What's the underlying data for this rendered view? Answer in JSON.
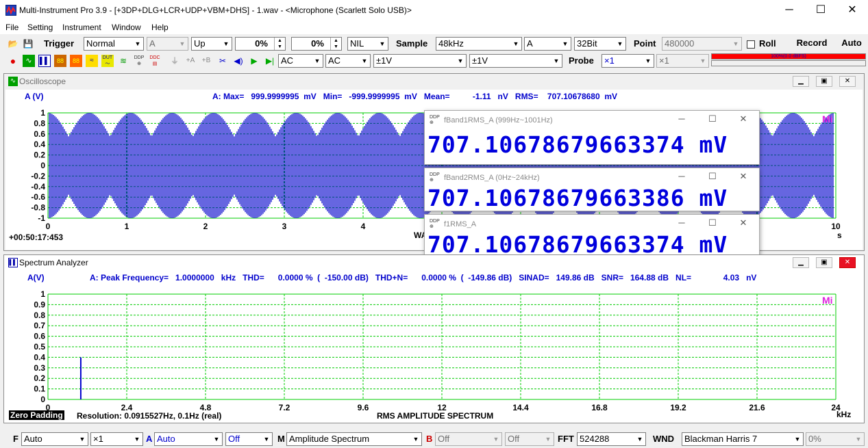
{
  "titlebar": {
    "title": "Multi-Instrument Pro 3.9   -   [+3DP+DLG+LCR+UDP+VBM+DHS]   -   1.wav   -   <Microphone (Scarlett Solo USB)>",
    "minimize": "─",
    "maximize": "☐",
    "close": "✕"
  },
  "menu": [
    "File",
    "Setting",
    "Instrument",
    "Window",
    "Help"
  ],
  "toolbar1": {
    "trigger_label": "Trigger",
    "trigger_mode": "Normal",
    "trigger_channel": "A",
    "trigger_edge": "Up",
    "trigger_level": "0%",
    "trigger_delay": "0%",
    "trigger_nil": "NIL",
    "sample_label": "Sample",
    "sample_rate": "48kHz",
    "sample_channel": "A",
    "bit_depth": "32Bit",
    "point_label": "Point",
    "point_value": "480000",
    "roll_label": "Roll",
    "record_label": "Record",
    "auto_label": "Auto"
  },
  "toolbar2": {
    "coupling_a": "AC",
    "coupling_b": "AC",
    "range_a": "±1V",
    "range_b": "±1V",
    "probe_label": "Probe",
    "probe_a": "×1",
    "probe_b": "×1",
    "level_meter": "100%(0.0 dBFS)",
    "icons": [
      "record-icon",
      "oscilloscope-icon",
      "spectrum-icon",
      "multimeter-icon",
      "generator-icon",
      "dut-icon",
      "sweep-icon",
      "ddp-icon",
      "ddc-icon",
      "probe-icon",
      "add-a-icon",
      "add-b-icon",
      "scissors-icon",
      "speaker-icon",
      "play-icon",
      "step-icon"
    ]
  },
  "oscilloscope": {
    "title": "Oscilloscope",
    "channel": "A (V)",
    "stats": "A: Max=   999.9999995  mV   Min=   -999.9999995  mV   Mean=          -1.11   nV   RMS=    707.10678680  mV",
    "timestamp": "+00:50:17:453",
    "xlabel": "WAVEFORM",
    "xunit": "s",
    "watermark": "Mi",
    "yticks": [
      "1",
      "0.8",
      "0.6",
      "0.4",
      "0.2",
      "0",
      "-0.2",
      "-0.4",
      "-0.6",
      "-0.8",
      "-1"
    ],
    "xticks": [
      "0",
      "1",
      "2",
      "3",
      "4",
      "",
      "",
      "",
      "",
      "",
      "10"
    ],
    "wave_color": "#0000cc",
    "grid_color": "#00cc00"
  },
  "floating_windows": [
    {
      "title": "fBand1RMS_A (999Hz~1001Hz)",
      "value": "707.10678679663374  mV"
    },
    {
      "title": "fBand2RMS_A (0Hz~24kHz)",
      "value": "707.10678679663386  mV"
    },
    {
      "title": "f1RMS_A",
      "value": "707.10678679663374  mV"
    }
  ],
  "spectrum": {
    "title": "Spectrum Analyzer",
    "channel": "A(V)",
    "stats": "A: Peak Frequency=   1.0000000   kHz   THD=      0.0000 %  (  -150.00 dB)   THD+N=      0.0000 %  (  -149.86 dB)   SINAD=   149.86 dB   SNR=   164.88 dB   NL=              4.03   nV",
    "zero_padding": "Zero Padding",
    "resolution": "Resolution: 0.0915527Hz, 0.1Hz (real)",
    "xlabel": "RMS AMPLITUDE  SPECTRUM",
    "xunit": "kHz",
    "watermark": "Mi",
    "yticks": [
      "1",
      "0.9",
      "0.8",
      "0.7",
      "0.6",
      "0.5",
      "0.4",
      "0.3",
      "0.2",
      "0.1",
      "0"
    ],
    "xticks": [
      "0",
      "2.4",
      "4.8",
      "7.2",
      "9.6",
      "12",
      "14.4",
      "16.8",
      "19.2",
      "21.6",
      "24"
    ]
  },
  "chart_data": {
    "type": "bar",
    "x": [
      1.0
    ],
    "values": [
      0.4
    ],
    "xlim": [
      0,
      24
    ],
    "ylim": [
      0,
      1
    ],
    "xlabel": "RMS AMPLITUDE  SPECTRUM",
    "ylabel": "A(V)"
  },
  "bottombar": {
    "f_label": "F",
    "f_value": "Auto",
    "f_mult": "×1",
    "a_label": "A",
    "a_value": "Auto",
    "a_off": "Off",
    "m_label": "M",
    "m_value": "Amplitude Spectrum",
    "b_label": "B",
    "b_value": "Off",
    "b_off": "Off",
    "fft_label": "FFT",
    "fft_value": "524288",
    "wnd_label": "WND",
    "wnd_value": "Blackman Harris 7",
    "overlap": "0%"
  }
}
